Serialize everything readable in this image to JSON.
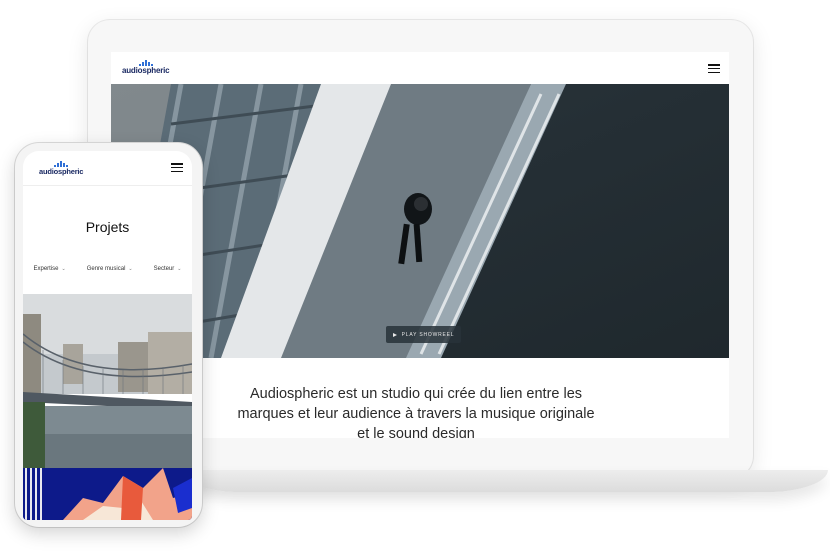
{
  "brand": {
    "logo_text": "audiospheric",
    "accent": "#2f6fd6",
    "ink": "#1b2a63"
  },
  "laptop": {
    "menu_icon": "hamburger-icon",
    "hero": {
      "play_label": "PLAY SHOWREEL",
      "play_icon": "play-icon"
    },
    "intro_text": "Audiospheric est un studio qui crée du lien entre les marques et leur audience à travers la musique originale et le sound design"
  },
  "phone": {
    "menu_icon": "hamburger-icon",
    "title": "Projets",
    "filters": [
      {
        "label": "Expertise"
      },
      {
        "label": "Genre musical"
      },
      {
        "label": "Secteur"
      }
    ],
    "filter_chevron": "⌄"
  }
}
